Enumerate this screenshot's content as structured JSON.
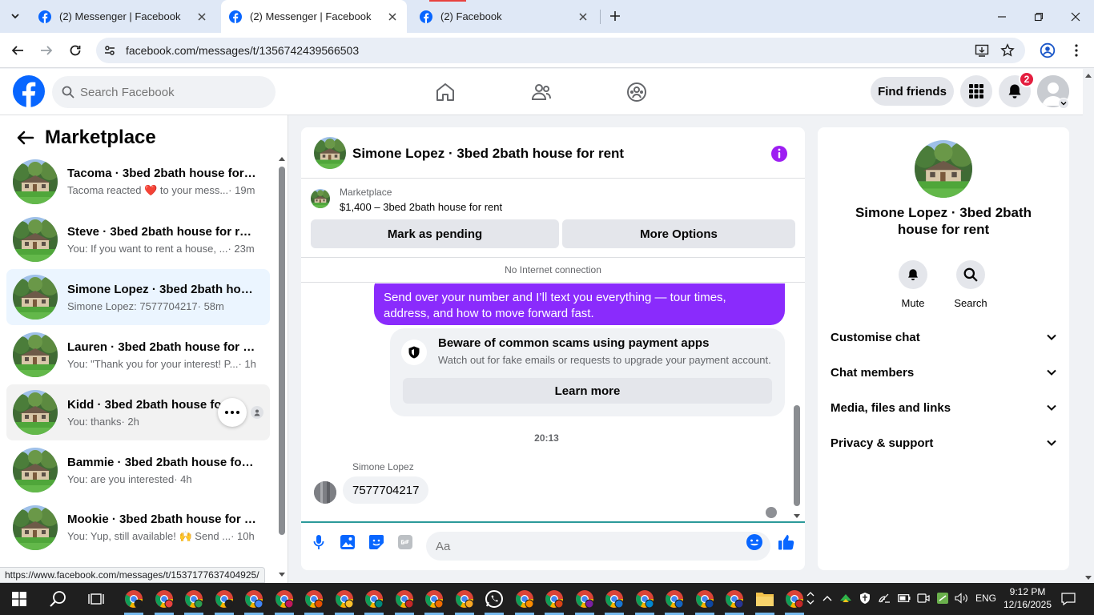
{
  "browser": {
    "tabs": [
      {
        "title": "(2) Messenger | Facebook",
        "active": false
      },
      {
        "title": "(2) Messenger | Facebook",
        "active": true
      },
      {
        "title": "(2) Facebook",
        "active": false
      }
    ],
    "url": "facebook.com/messages/t/1356742439566503",
    "status_url": "https://www.facebook.com/messages/t/1537177637404925/"
  },
  "facebook": {
    "search_placeholder": "Search Facebook",
    "find_friends": "Find friends",
    "notification_count": "2",
    "brand_color": "#0866ff"
  },
  "left_panel": {
    "title": "Marketplace",
    "conversations": [
      {
        "name": "Tacoma · 3bed 2bath house for r...",
        "preview_before": "Tacoma reacted ",
        "reaction": "❤️",
        "preview_after": " to your mess...",
        "time": " · 19m"
      },
      {
        "name": "Steve · 3bed 2bath house for rent",
        "preview_before": "You: If you want to rent a house, ...",
        "time": " · 23m"
      },
      {
        "name": "Simone Lopez · 3bed 2bath hou...",
        "preview_before": "Simone Lopez: 7577704217",
        "time": " · 58m",
        "selected": true
      },
      {
        "name": "Lauren · 3bed 2bath house for r...",
        "preview_before": "You: \"Thank you for your interest! P...",
        "time": " · 1h"
      },
      {
        "name": "Kidd · 3bed 2bath house for r...",
        "preview_before": "You: thanks",
        "time": " · 2h",
        "hover": true
      },
      {
        "name": "Bammie · 3bed 2bath house for ...",
        "preview_before": "You: are you interested",
        "time": " · 4h"
      },
      {
        "name": "Mookie · 3bed 2bath house for r...",
        "preview_before": "You: Yup, still available! 🙌 Send ...",
        "time": " · 10h"
      }
    ]
  },
  "chat": {
    "title": "Simone Lopez · 3bed 2bath house for rent",
    "marketplace_label": "Marketplace",
    "listing": "$1,400 – 3bed 2bath house for rent",
    "mark_pending": "Mark as pending",
    "more_options": "More Options",
    "no_internet": "No Internet connection",
    "outgoing_message": "Send over your number and I’ll text you everything — tour times, address, and how to move forward fast.",
    "warning_title": "Beware of common scams using payment apps",
    "warning_body": "Watch out for fake emails or requests to upgrade your payment account.",
    "learn_more": "Learn more",
    "timestamp": "20:13",
    "sender": "Simone Lopez",
    "incoming_message": "7577704217",
    "composer_placeholder": "Aa",
    "accent_color": "#8a2bfc"
  },
  "details": {
    "name": "Simone Lopez · 3bed 2bath house for rent",
    "mute": "Mute",
    "search": "Search",
    "sections": [
      "Customise chat",
      "Chat members",
      "Media, files and links",
      "Privacy & support"
    ]
  },
  "taskbar": {
    "language": "ENG",
    "time": "9:12 PM",
    "date": "12/16/2025"
  }
}
